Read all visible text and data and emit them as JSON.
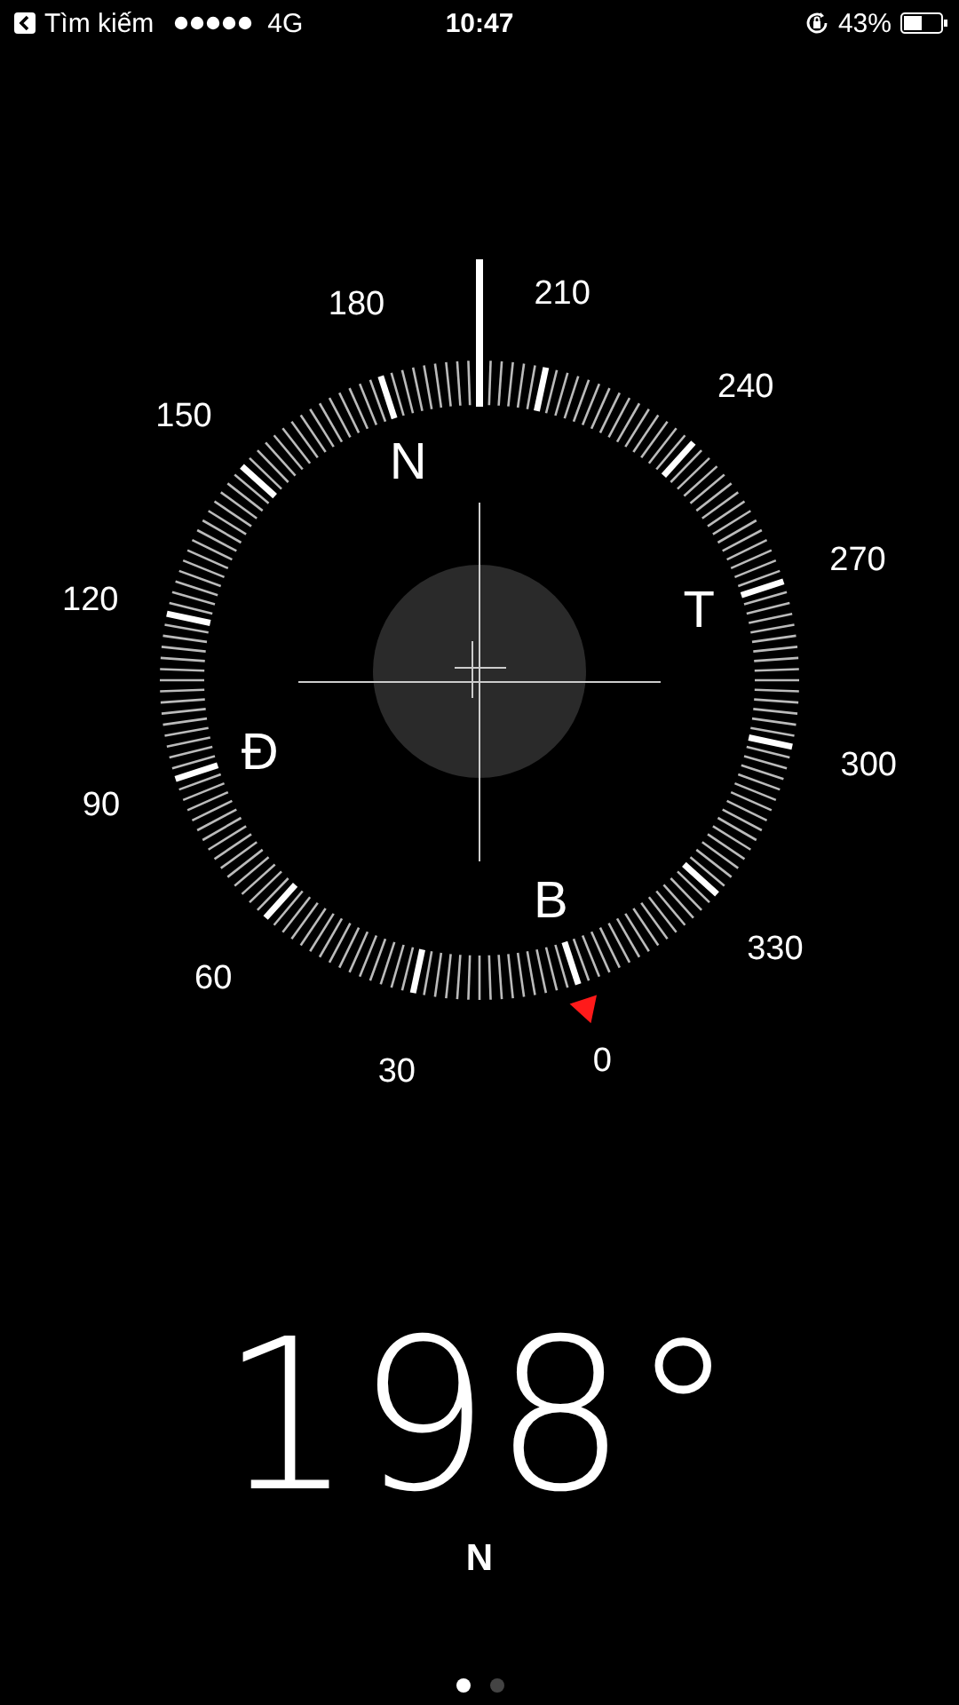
{
  "status_bar": {
    "back_label": "Tìm kiếm",
    "network": "4G",
    "time": "10:47",
    "battery": "43%"
  },
  "compass": {
    "degree_labels": [
      "0",
      "30",
      "60",
      "90",
      "120",
      "150",
      "180",
      "210",
      "240",
      "270",
      "300",
      "330"
    ],
    "cardinals": [
      "B",
      "Đ",
      "N",
      "T"
    ]
  },
  "heading": {
    "degrees": "198°",
    "direction": "N"
  },
  "pages": [
    {
      "selected": true
    },
    {
      "selected": false
    }
  ]
}
